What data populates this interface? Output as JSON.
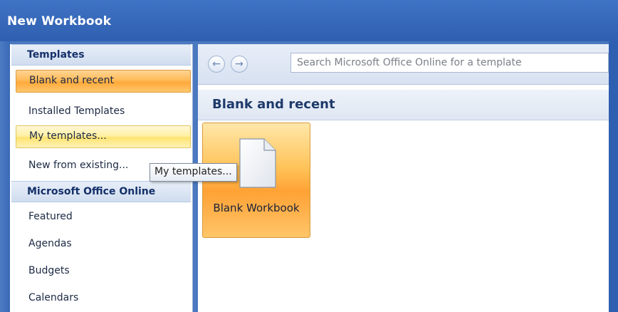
{
  "window": {
    "title": "New Workbook"
  },
  "sidebar": {
    "templates_header": "Templates",
    "items_templates": [
      {
        "label": "Blank and recent",
        "state": "selected"
      },
      {
        "label": "Installed Templates",
        "state": "normal"
      },
      {
        "label": "My templates...",
        "state": "hover"
      },
      {
        "label": "New from existing...",
        "state": "normal"
      }
    ],
    "online_header": "Microsoft Office Online",
    "items_online": [
      {
        "label": "Featured"
      },
      {
        "label": "Agendas"
      },
      {
        "label": "Budgets"
      },
      {
        "label": "Calendars"
      }
    ]
  },
  "toolbar": {
    "back_icon": "back-arrow-icon",
    "forward_icon": "forward-arrow-icon",
    "search_placeholder": "Search Microsoft Office Online for a template"
  },
  "main": {
    "section_title": "Blank and recent",
    "tiles": [
      {
        "label": "Blank Workbook",
        "icon": "blank-document-icon",
        "selected": true
      }
    ]
  },
  "tooltip": {
    "text": "My templates..."
  },
  "colors": {
    "title_bar": "#3f73c4",
    "selected_orange": "#ffb24a",
    "hover_yellow": "#ffe98a",
    "header_text": "#15306a"
  }
}
